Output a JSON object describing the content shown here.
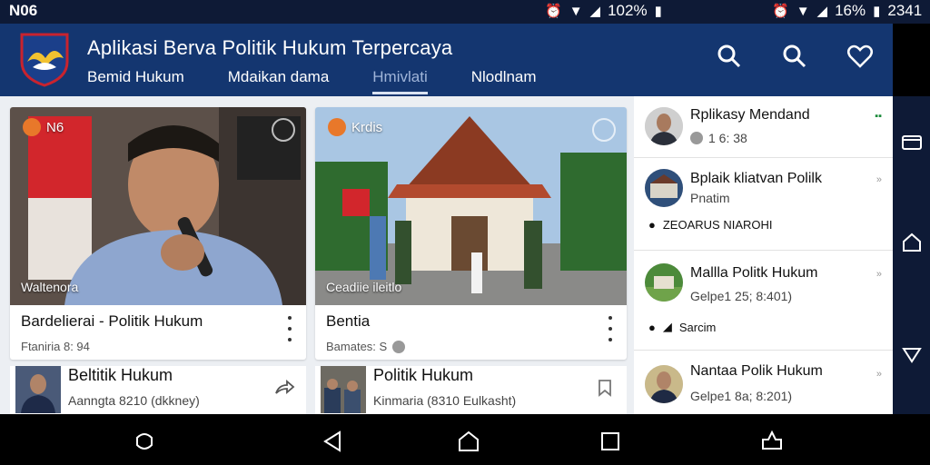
{
  "status_bar": {
    "left_text": "N06",
    "mid_battery": "102%",
    "right_battery": "16%",
    "time": "2341"
  },
  "app_bar": {
    "title": "Aplikasi Berva Politik Hukum Terpercaya",
    "tabs": [
      {
        "label": "Bemid Hukum",
        "active": false
      },
      {
        "label": "Mdaikan dama",
        "active": false
      },
      {
        "label": "Hmivlati",
        "active": true
      },
      {
        "label": "Nlodlnam",
        "active": false
      }
    ],
    "icons": [
      "search-icon",
      "search-icon",
      "heart-icon"
    ]
  },
  "cards": [
    {
      "badge": "N6",
      "caption": "Waltenora",
      "title": "Bardelierai - Politik Hukum",
      "meta": "Ftaniria 8: 94"
    },
    {
      "badge": "Krdis",
      "caption": "Ceadiie ileitlo",
      "title": "Bentia",
      "meta": "Bamates: S"
    }
  ],
  "rows": [
    {
      "title": "Beltitik Hukum",
      "meta": "Aanngta 8210 (dkkney)"
    },
    {
      "title": "Politik Hukum",
      "meta": "Kinmaria (8310 Eulkasht)"
    }
  ],
  "side_items": [
    {
      "title": "Rplikasy Mendand",
      "meta": "1 6: 38",
      "extra": ""
    },
    {
      "title": "Bplaik kliatvan Polilk",
      "meta": "Pnatim",
      "extra": "ZEOARUS NIAROHI"
    },
    {
      "title": "Mallla Politk Hukum",
      "meta": "Gelpe1 25; 8:401)",
      "extra": "Sarcim"
    },
    {
      "title": "Nantaa Polik Hukum",
      "meta": "Gelpe1 8a; 8:201)",
      "extra": ""
    }
  ],
  "colors": {
    "app_bar": "#143670",
    "status_bar": "#0e1a36",
    "badge": "#e8782a"
  }
}
